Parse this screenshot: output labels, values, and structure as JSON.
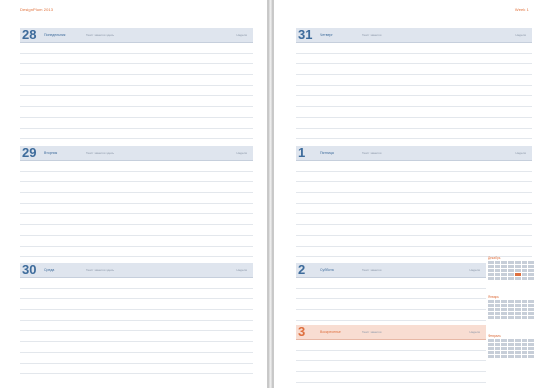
{
  "header": {
    "left_title": "DesignPlum 2013",
    "right_title": "Week 1"
  },
  "left_page": {
    "days": [
      {
        "number": "28",
        "weekday": "Понедельник",
        "note": "Текст заметки здесь",
        "week": "Неделя"
      },
      {
        "number": "29",
        "weekday": "Вторник",
        "note": "Текст заметки здесь",
        "week": "Неделя"
      },
      {
        "number": "30",
        "weekday": "Среда",
        "note": "Текст заметки здесь",
        "week": "Неделя"
      }
    ]
  },
  "right_page": {
    "days": [
      {
        "number": "31",
        "weekday": "Четверг",
        "note": "Текст заметки",
        "week": "Неделя",
        "highlight": false
      },
      {
        "number": "1",
        "weekday": "Пятница",
        "note": "Текст заметки",
        "week": "Неделя",
        "highlight": false
      },
      {
        "number": "2",
        "weekday": "Суббота",
        "note": "Текст заметки",
        "week": "Неделя",
        "highlight": false
      },
      {
        "number": "3",
        "weekday": "Воскресенье",
        "note": "Текст заметки",
        "week": "Неделя",
        "highlight": true
      }
    ]
  },
  "mini_calendars": [
    {
      "month": "Декабрь"
    },
    {
      "month": "Январь"
    },
    {
      "month": "Февраль"
    }
  ],
  "colors": {
    "accent_blue": "#3d6b9b",
    "accent_orange": "#de6f3e",
    "bar_blue": "#dfe5ee",
    "bar_orange": "#f8ddd2"
  }
}
